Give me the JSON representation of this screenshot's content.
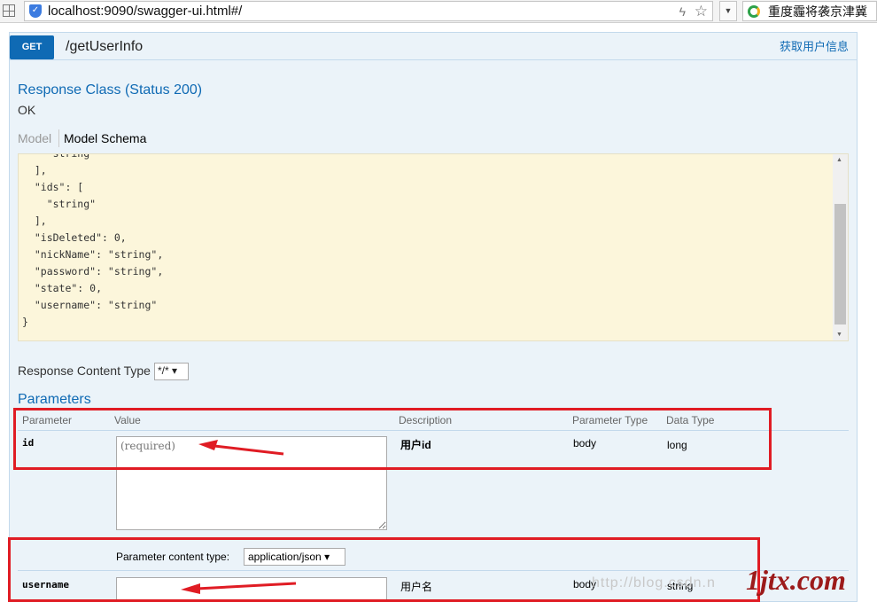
{
  "browser": {
    "url": "localhost:9090/swagger-ui.html#/",
    "search_text": "重度霾将袭京津冀"
  },
  "operation": {
    "method": "GET",
    "path": "/getUserInfo",
    "summary": "获取用户信息"
  },
  "response": {
    "class_title": "Response Class (Status 200)",
    "class_value": "OK",
    "tabs": {
      "model": "Model",
      "schema": "Model Schema"
    },
    "schema_text": "    \"string\"\n  ],\n  \"ids\": [\n    \"string\"\n  ],\n  \"isDeleted\": 0,\n  \"nickName\": \"string\",\n  \"password\": \"string\",\n  \"state\": 0,\n  \"username\": \"string\"\n}",
    "content_type_label": "Response Content Type",
    "content_type_value": "*/*"
  },
  "parameters": {
    "title": "Parameters",
    "headers": [
      "Parameter",
      "Value",
      "Description",
      "Parameter Type",
      "Data Type"
    ],
    "rows": [
      {
        "name": "id",
        "placeholder": "(required)",
        "description": "用户id",
        "param_type": "body",
        "data_type": "long"
      },
      {
        "name": "username",
        "placeholder": "",
        "description": "用户名",
        "param_type": "body",
        "data_type": "string"
      }
    ],
    "content_type_label": "Parameter content type:",
    "content_type_value": "application/json"
  },
  "watermark": {
    "text": "http://blog.csdn.n",
    "logo": "1jtx.com"
  },
  "colors": {
    "accent": "#0f6ab4",
    "annotation": "#e01c24",
    "panel": "#ebf3f9",
    "schema_bg": "#fcf6db"
  }
}
